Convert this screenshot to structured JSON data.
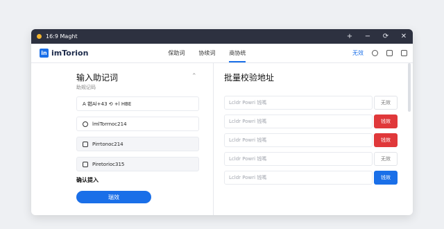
{
  "window": {
    "title": "16:9 Maght"
  },
  "titlebar": {
    "controls": [
      "+",
      "−",
      "⟳",
      "✕"
    ]
  },
  "brand": {
    "logo": "in",
    "name": "imTorion"
  },
  "nav": {
    "tabs": [
      "保助词",
      "协续词",
      "商协统"
    ],
    "active_index": 2
  },
  "toolbar": {
    "link": "无效",
    "icons": [
      "circle-icon",
      "image-icon",
      "document-icon"
    ]
  },
  "left": {
    "title": "输入助记词",
    "subtitle": "助规记码",
    "collapse_glyph": "⌃",
    "header_row": "A 钳Al+43  ⟲  +l HBE",
    "items": [
      {
        "icon": "chat-bubble-icon",
        "text": "lmlTorrnoc214"
      },
      {
        "icon": "window-icon",
        "text": "Pirrtonoc214"
      },
      {
        "icon": "window-icon",
        "text": "Piretorioc315"
      }
    ],
    "confirm_label": "确认提入",
    "verify_button": "瑞效"
  },
  "right": {
    "title": "批量校验地址",
    "rows": [
      {
        "placeholder": "Lcldr Powri 钱嗎",
        "status": "无效",
        "kind": "invalid"
      },
      {
        "placeholder": "Lcldr Powri 钱嗎",
        "status": "钱效",
        "kind": "red"
      },
      {
        "placeholder": "Lcldr Powri 钱嗎",
        "status": "钱效",
        "kind": "red"
      },
      {
        "placeholder": "Lcldr Powri 钱嗎",
        "status": "无效",
        "kind": "invalid"
      },
      {
        "placeholder": "Lcldr Powri 钱嗎",
        "status": "钱效",
        "kind": "blue"
      }
    ]
  },
  "colors": {
    "accent": "#1a6fe8",
    "danger": "#e0383a",
    "titlebar": "#2d3140"
  }
}
